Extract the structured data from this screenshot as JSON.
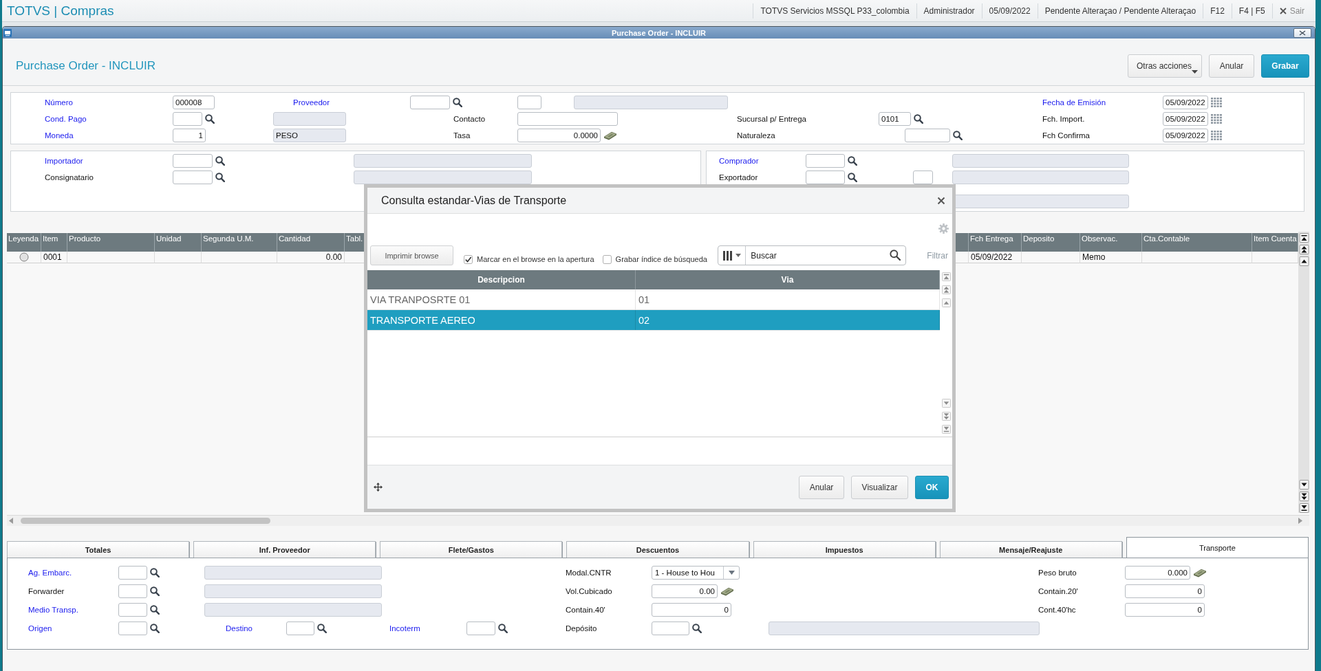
{
  "app_bar": {
    "title": "TOTVS | Compras",
    "info": [
      "TOTVS Servicios MSSQL P33_colombia",
      "Administrador",
      "05/09/2022",
      "Pendente Alteraçao / Pendente Alteraçao"
    ],
    "shortcuts": [
      "F12",
      "F4 | F5"
    ],
    "exit": "Sair"
  },
  "window": {
    "title": "Purchase Order - INCLUIR"
  },
  "header": {
    "title": "Purchase Order - INCLUIR",
    "buttons": [
      {
        "label": "Otras acciones",
        "kind": "menu"
      },
      {
        "label": "Anular",
        "kind": "secondary"
      },
      {
        "label": "Grabar",
        "kind": "primary"
      }
    ]
  },
  "form": {
    "fields": [
      {
        "label": "Número",
        "required": true,
        "controls": [
          {
            "kind": "input",
            "value": "000008"
          }
        ]
      },
      {
        "label": "Proveedor",
        "required": true,
        "controls": [
          {
            "kind": "lookup"
          },
          {
            "kind": "input"
          },
          {
            "kind": "readonly"
          }
        ]
      },
      {
        "label": "Fecha de Emisión",
        "required": true,
        "controls": [
          {
            "kind": "date",
            "value": "05/09/2022"
          }
        ]
      },
      {
        "label": "Cond. Pago",
        "required": true,
        "controls": [
          {
            "kind": "lookup"
          },
          {
            "kind": "readonly"
          }
        ]
      },
      {
        "label": "Contacto",
        "required": false,
        "controls": [
          {
            "kind": "input"
          }
        ]
      },
      {
        "label": "Sucursal p/ Entrega",
        "required": false,
        "controls": [
          {
            "kind": "lookup",
            "value": "0101"
          }
        ]
      },
      {
        "label": "Fch. Import.",
        "required": false,
        "controls": [
          {
            "kind": "date",
            "value": "05/09/2022"
          }
        ]
      },
      {
        "label": "Moneda",
        "required": true,
        "controls": [
          {
            "kind": "number",
            "value": "1"
          },
          {
            "kind": "readonly",
            "value": "PESO"
          }
        ]
      },
      {
        "label": "Tasa",
        "required": false,
        "controls": [
          {
            "kind": "amount",
            "value": "0.0000"
          }
        ]
      },
      {
        "label": "Naturaleza",
        "required": false,
        "controls": [
          {
            "kind": "lookup"
          }
        ]
      },
      {
        "label": "Fch Confirma",
        "required": false,
        "controls": [
          {
            "kind": "date",
            "value": "05/09/2022"
          }
        ]
      }
    ]
  },
  "importer_panel": {
    "fields": [
      {
        "label": "Importador",
        "required": true,
        "controls": [
          {
            "kind": "lookup"
          },
          {
            "kind": "readonly"
          }
        ]
      },
      {
        "label": "Consignatario",
        "required": false,
        "controls": [
          {
            "kind": "lookup"
          },
          {
            "kind": "readonly"
          }
        ]
      }
    ]
  },
  "buyer_panel": {
    "fields": [
      {
        "label": "Comprador",
        "required": true,
        "controls": [
          {
            "kind": "lookup"
          },
          {
            "kind": "readonly"
          }
        ]
      },
      {
        "label": "Exportador",
        "required": false,
        "controls": [
          {
            "kind": "lookup"
          },
          {
            "kind": "input"
          },
          {
            "kind": "readonly"
          }
        ]
      },
      {
        "controls": [
          {
            "kind": "readonly"
          }
        ]
      }
    ]
  },
  "items_grid": {
    "columns": [
      "Leyenda",
      "Item",
      "Producto",
      "Unidad",
      "Segunda U.M.",
      "Cantidad",
      "Tabl.",
      "Fch Entrega",
      "Deposito",
      "Observac.",
      "Cta.Contable",
      "Item Cuenta"
    ],
    "rows": [
      {
        "cells": [
          null,
          "0001",
          null,
          null,
          null,
          "0.00",
          null,
          "05/09/2022",
          null,
          "Memo",
          null,
          null
        ]
      }
    ]
  },
  "folder_tabs": [
    {
      "label": "Totales",
      "selected": false
    },
    {
      "label": "Inf. Proveedor",
      "selected": false
    },
    {
      "label": "Flete/Gastos",
      "selected": false
    },
    {
      "label": "Descuentos",
      "selected": false
    },
    {
      "label": "Impuestos",
      "selected": false
    },
    {
      "label": "Mensaje/Reajuste",
      "selected": false
    },
    {
      "label": "Transporte",
      "selected": true
    }
  ],
  "transport_panel": {
    "fields": [
      {
        "label": "Ag. Embarc.",
        "required": true,
        "controls": [
          {
            "kind": "lookup"
          },
          {
            "kind": "readonly"
          }
        ]
      },
      {
        "label": "Modal.CNTR",
        "required": false,
        "controls": [
          {
            "kind": "combo",
            "value": "1 - House to Hou"
          }
        ]
      },
      {
        "label": "Peso bruto",
        "required": false,
        "controls": [
          {
            "kind": "amount",
            "value": "0.000"
          }
        ]
      },
      {
        "label": "Forwarder",
        "required": false,
        "controls": [
          {
            "kind": "lookup"
          },
          {
            "kind": "readonly"
          }
        ]
      },
      {
        "label": "Vol.Cubicado",
        "required": false,
        "controls": [
          {
            "kind": "amount",
            "value": "0.00"
          }
        ]
      },
      {
        "label": "Contain.20'",
        "required": false,
        "controls": [
          {
            "kind": "number",
            "value": "0"
          }
        ]
      },
      {
        "label": "Medio Transp.",
        "required": true,
        "controls": [
          {
            "kind": "lookup"
          },
          {
            "kind": "readonly"
          }
        ]
      },
      {
        "label": "Contain.40'",
        "required": false,
        "controls": [
          {
            "kind": "number",
            "value": "0"
          }
        ]
      },
      {
        "label": "Cont.40'hc",
        "required": false,
        "controls": [
          {
            "kind": "number",
            "value": "0"
          }
        ]
      },
      {
        "label": "Origen",
        "required": true,
        "controls": [
          {
            "kind": "lookup"
          }
        ]
      },
      {
        "label": "Destino",
        "required": true,
        "controls": [
          {
            "kind": "lookup"
          }
        ]
      },
      {
        "label": "Incoterm",
        "required": true,
        "controls": [
          {
            "kind": "lookup"
          }
        ]
      },
      {
        "label": "Depósito",
        "required": false,
        "controls": [
          {
            "kind": "lookup"
          },
          {
            "kind": "readonly"
          }
        ]
      }
    ]
  },
  "lookup_dialog": {
    "title": "Consulta estandar-Vias de Transporte",
    "print_button": "Imprimir browse",
    "options": [
      {
        "label": "Marcar en el browse en la apertura",
        "checked": true
      },
      {
        "label": "Grabar índice de búsqueda",
        "checked": false
      }
    ],
    "search": {
      "placeholder": "Buscar"
    },
    "filter": "Filtrar",
    "table": {
      "columns": [
        "Descripcion",
        "Via"
      ],
      "rows": [
        {
          "cells": [
            "VIA TRANPOSRTE 01",
            "01"
          ],
          "selected": false
        },
        {
          "cells": [
            "TRANSPORTE AEREO",
            "02"
          ],
          "selected": true
        }
      ]
    },
    "buttons": [
      {
        "label": "Anular",
        "kind": "secondary"
      },
      {
        "label": "Visualizar",
        "kind": "secondary"
      },
      {
        "label": "OK",
        "kind": "primary"
      }
    ]
  }
}
